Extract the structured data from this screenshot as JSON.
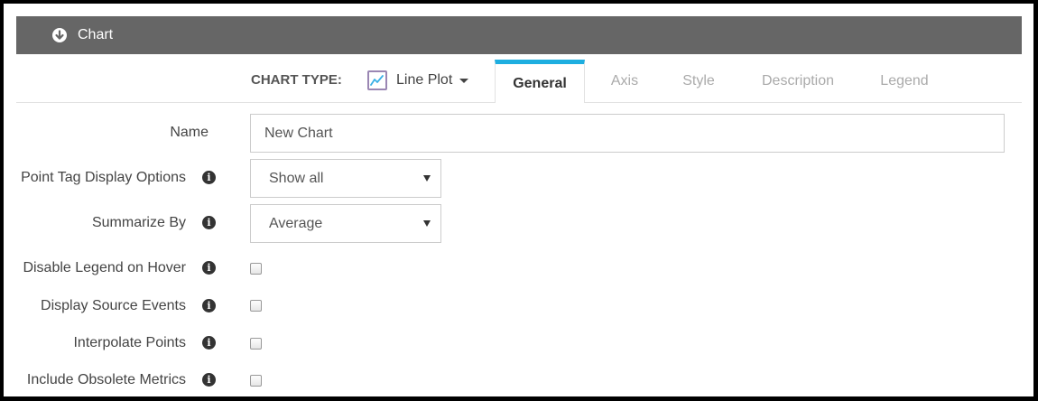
{
  "panel": {
    "title": "Chart",
    "toggle_icon": "arrow-down-circle-icon"
  },
  "chart_type": {
    "label": "CHART TYPE:",
    "value": "Line Plot",
    "icon": "line-plot-icon"
  },
  "tabs": [
    {
      "label": "General",
      "active": true
    },
    {
      "label": "Axis",
      "active": false
    },
    {
      "label": "Style",
      "active": false
    },
    {
      "label": "Description",
      "active": false
    },
    {
      "label": "Legend",
      "active": false
    }
  ],
  "form": {
    "name": {
      "label": "Name",
      "value": "New Chart"
    },
    "point_tag": {
      "label": "Point Tag Display Options",
      "value": "Show all"
    },
    "summarize_by": {
      "label": "Summarize By",
      "value": "Average"
    },
    "disable_legend_hover": {
      "label": "Disable Legend on Hover",
      "checked": false
    },
    "display_source_events": {
      "label": "Display Source Events",
      "checked": false
    },
    "interpolate_points": {
      "label": "Interpolate Points",
      "checked": false
    },
    "include_obsolete_metrics": {
      "label": "Include Obsolete Metrics",
      "checked": false
    }
  },
  "colors": {
    "header_bg": "#666666",
    "active_tab_accent": "#1eaee0",
    "inactive_tab_text": "#aaaaaa"
  }
}
